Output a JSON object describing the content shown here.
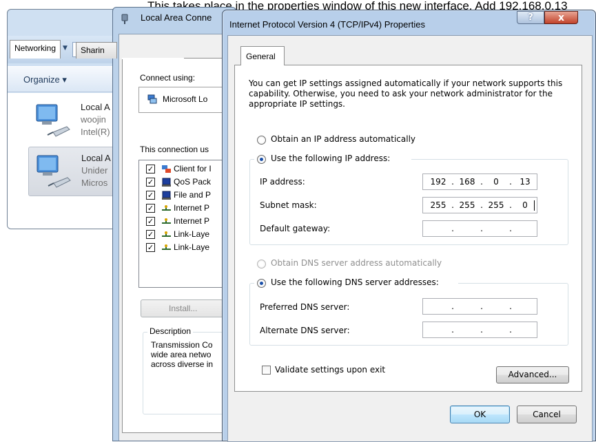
{
  "caption": "This takes place in the properties window of this new interface. Add 192.168.0.13",
  "explorer": {
    "address_crumb": "«",
    "organize_label": "Organize ▾",
    "connections": [
      {
        "name": "Local A",
        "line2": "woojin",
        "line3": "Intel(R)"
      },
      {
        "name": "Local A",
        "line2": "Unider",
        "line3": "Micros"
      }
    ]
  },
  "lacp": {
    "title": "Local Area Conne",
    "tab_networking": "Networking",
    "tab_sharing": "Sharin",
    "connect_using_label": "Connect using:",
    "adapter_name": "Microsoft Lo",
    "components_label": "This connection us",
    "components": [
      {
        "label": "Client for I",
        "checked": true
      },
      {
        "label": "QoS Pack",
        "checked": true
      },
      {
        "label": "File and P",
        "checked": true
      },
      {
        "label": "Internet P",
        "checked": true
      },
      {
        "label": "Internet P",
        "checked": true
      },
      {
        "label": "Link-Laye",
        "checked": true
      },
      {
        "label": "Link-Laye",
        "checked": true
      }
    ],
    "install_label": "Install...",
    "description_label": "Description",
    "description_lines": [
      "Transmission Co",
      "wide area netwo",
      "across diverse in"
    ]
  },
  "ipv4": {
    "title": "Internet Protocol Version 4 (TCP/IPv4) Properties",
    "help_label": "?",
    "close_label": "x",
    "tab_general": "General",
    "intro": "You can get IP settings assigned automatically if your network supports this capability. Otherwise, you need to ask your network administrator for the appropriate IP settings.",
    "obtain_ip_auto": "Obtain an IP address automatically",
    "use_following_ip": "Use the following IP address:",
    "ip_address_label": "IP address:",
    "ip_address": [
      "192",
      "168",
      "0",
      "13"
    ],
    "subnet_mask_label": "Subnet mask:",
    "subnet_mask": [
      "255",
      "255",
      "255",
      "0"
    ],
    "default_gateway_label": "Default gateway:",
    "default_gateway": [
      "",
      "",
      "",
      ""
    ],
    "obtain_dns_auto": "Obtain DNS server address automatically",
    "use_following_dns": "Use the following DNS server addresses:",
    "preferred_dns_label": "Preferred DNS server:",
    "preferred_dns": [
      "",
      "",
      "",
      ""
    ],
    "alternate_dns_label": "Alternate DNS server:",
    "alternate_dns": [
      "",
      "",
      "",
      ""
    ],
    "validate_label": "Validate settings upon exit",
    "advanced_label": "Advanced...",
    "ok_label": "OK",
    "cancel_label": "Cancel"
  }
}
